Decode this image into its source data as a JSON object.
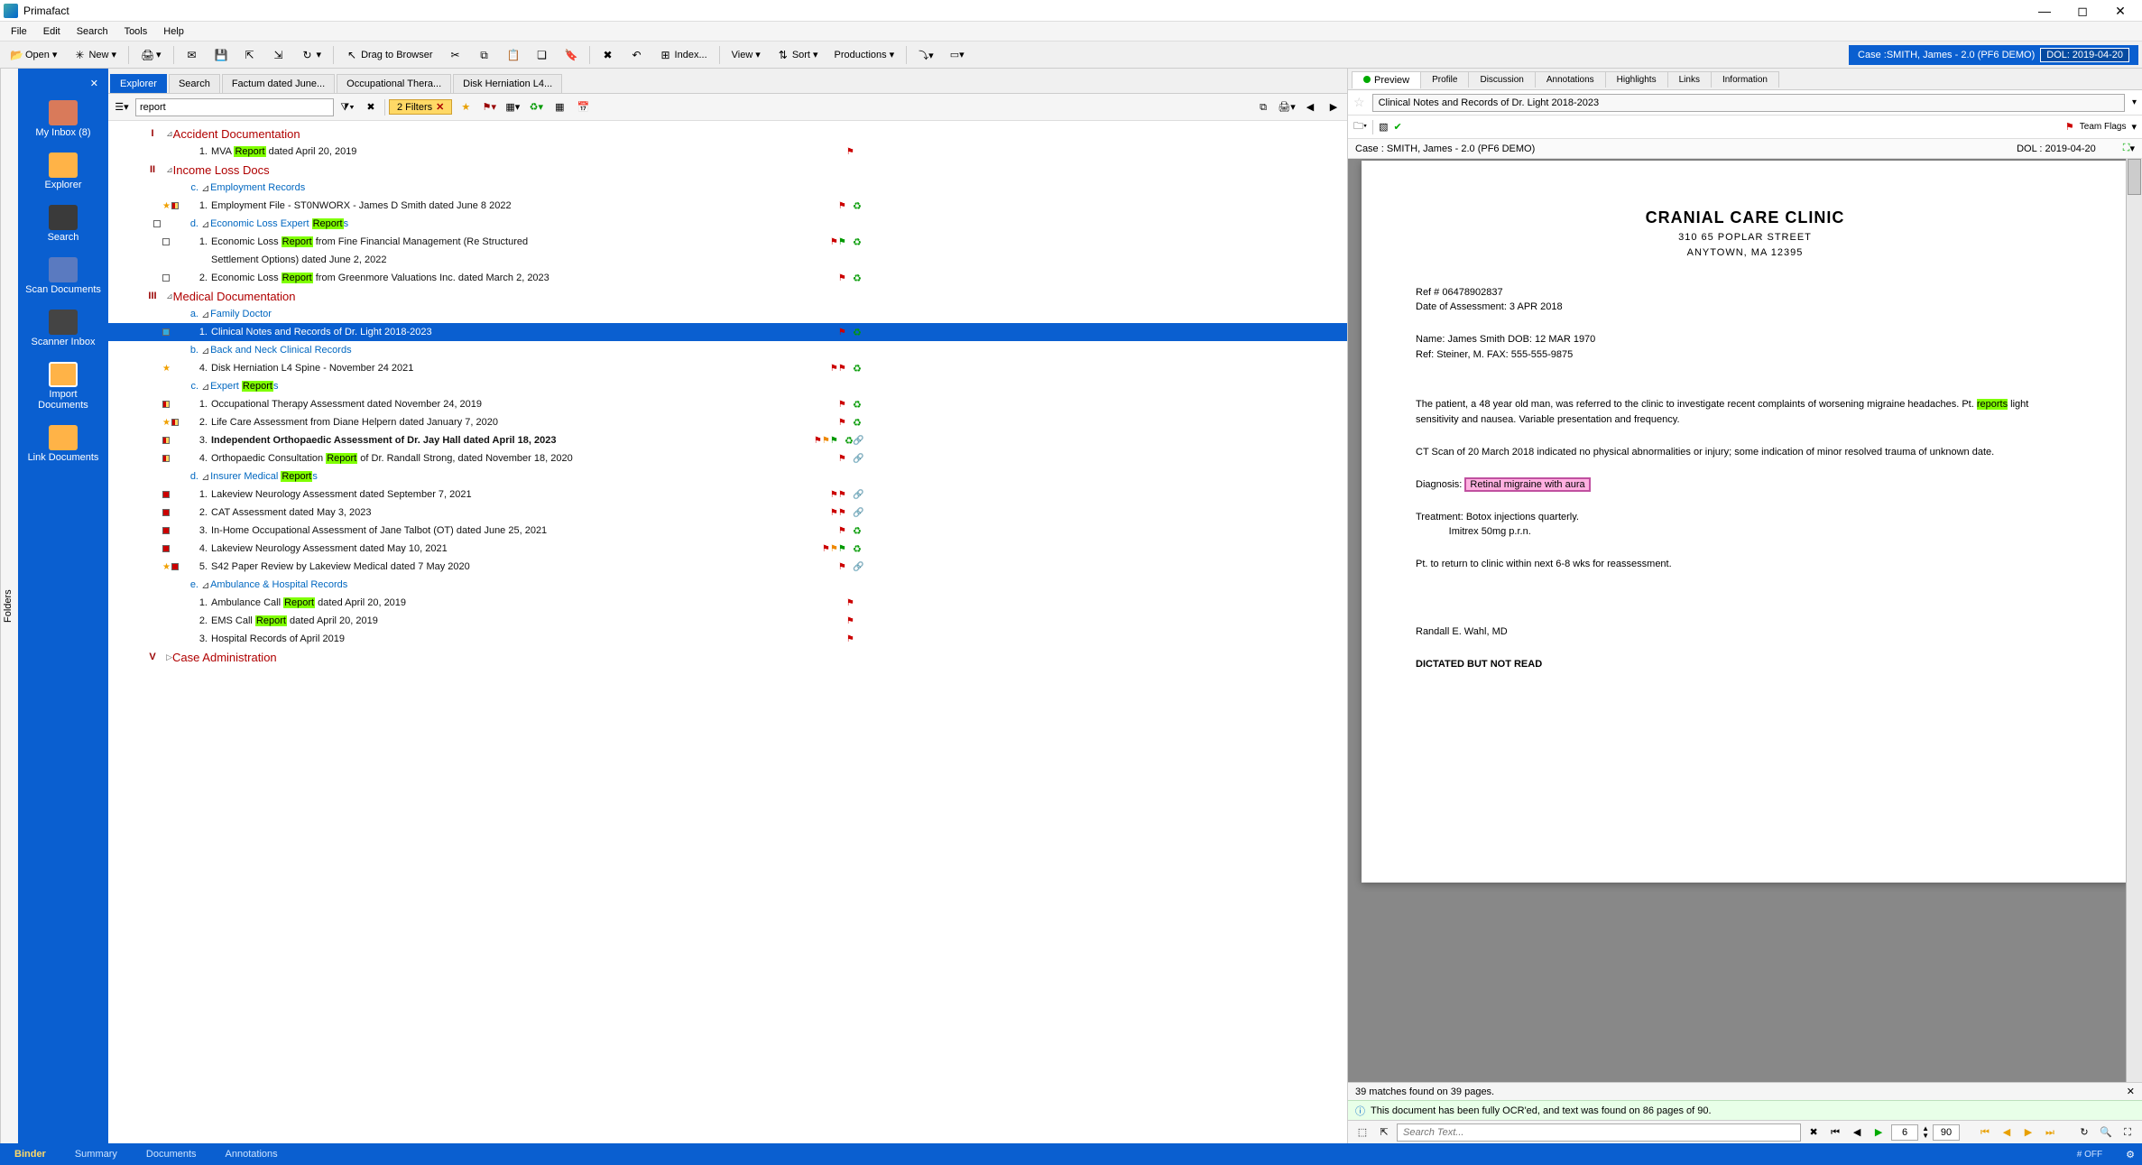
{
  "app": {
    "title": "Primafact"
  },
  "menu": [
    "File",
    "Edit",
    "Search",
    "Tools",
    "Help"
  ],
  "toolbar": {
    "open": "Open",
    "new": "New",
    "drag_to_browser": "Drag to Browser",
    "index": "Index...",
    "view": "View",
    "sort": "Sort",
    "productions": "Productions"
  },
  "case_banner": {
    "prefix": "Case : ",
    "name": "SMITH, James - 2.0 (PF6 DEMO)",
    "dol_label": "DOL:",
    "dol": "2019-04-20"
  },
  "leftbar": [
    {
      "id": "inbox",
      "label": "My Inbox (8)"
    },
    {
      "id": "explorer",
      "label": "Explorer"
    },
    {
      "id": "search",
      "label": "Search"
    },
    {
      "id": "scan",
      "label": "Scan Documents"
    },
    {
      "id": "scanner",
      "label": "Scanner Inbox"
    },
    {
      "id": "import",
      "label": "Import Documents"
    },
    {
      "id": "link",
      "label": "Link Documents"
    }
  ],
  "folders_tab": "Folders",
  "center_tabs": [
    "Explorer",
    "Search",
    "Factum dated June...",
    "Occupational Thera...",
    "Disk Herniation L4..."
  ],
  "explorer_search": {
    "value": "report",
    "filters_pill": "2 Filters"
  },
  "tree": [
    {
      "t": "sec",
      "num": "I",
      "title": "Accident Documentation"
    },
    {
      "t": "doc",
      "idx": "1.",
      "parts": [
        "MVA ",
        {
          "hl": "Report"
        },
        " dated April 20, 2019"
      ],
      "flags": [
        "red"
      ]
    },
    {
      "t": "sec",
      "num": "II",
      "title": "Income Loss Docs"
    },
    {
      "t": "sub",
      "ltr": "c.",
      "title": "Employment Records"
    },
    {
      "t": "doc",
      "idx": "1.",
      "gutter": "star-half",
      "parts": [
        "Employment File - ST0NWORX - James D Smith dated June 8 2022"
      ],
      "flags": [
        "red"
      ],
      "icons": [
        "recycle"
      ]
    },
    {
      "t": "sub",
      "ltr": "d.",
      "title_parts": [
        "Economic Loss Expert ",
        {
          "hl": "Report"
        },
        "s"
      ],
      "gutter": "sq"
    },
    {
      "t": "doc",
      "idx": "1.",
      "gutter": "sq",
      "parts": [
        "Economic Loss ",
        {
          "hl": "Report"
        },
        " from Fine Financial Management (Re Structured"
      ],
      "flags": [
        "red",
        "green"
      ],
      "icons": [
        "recycle"
      ]
    },
    {
      "t": "docc",
      "parts": [
        "Settlement Options) dated June 2, 2022"
      ]
    },
    {
      "t": "doc",
      "idx": "2.",
      "gutter": "sq",
      "parts": [
        "Economic Loss ",
        {
          "hl": "Report"
        },
        " from Greenmore Valuations Inc. dated March 2, 2023"
      ],
      "flags": [
        "red"
      ],
      "icons": [
        "recycle"
      ]
    },
    {
      "t": "sec",
      "num": "III",
      "title": "Medical Documentation"
    },
    {
      "t": "sub",
      "ltr": "a.",
      "title": "Family Doctor"
    },
    {
      "t": "doc",
      "idx": "1.",
      "selected": true,
      "gutter": "blue",
      "parts": [
        "Clinical Notes and Records of Dr. Light 2018-2023"
      ],
      "flags": [
        "red"
      ],
      "icons": [
        "recycle"
      ]
    },
    {
      "t": "sub",
      "ltr": "b.",
      "title": "Back and Neck Clinical Records"
    },
    {
      "t": "doc",
      "idx": "4.",
      "gutter": "star",
      "parts": [
        "Disk Herniation L4  Spine - November 24 2021"
      ],
      "flags": [
        "red",
        "red"
      ],
      "icons": [
        "recycle"
      ]
    },
    {
      "t": "sub",
      "ltr": "c.",
      "title_parts": [
        "Expert ",
        {
          "hl": "Report"
        },
        "s"
      ]
    },
    {
      "t": "doc",
      "idx": "1.",
      "gutter": "half",
      "parts": [
        "Occupational Therapy Assessment dated November 24, 2019"
      ],
      "flags": [
        "red"
      ],
      "icons": [
        "recycle"
      ]
    },
    {
      "t": "doc",
      "idx": "2.",
      "gutter": "star-half",
      "parts": [
        "Life Care Assessment from Diane Helpern dated January 7, 2020"
      ],
      "flags": [
        "red"
      ],
      "icons": [
        "recycle"
      ]
    },
    {
      "t": "doc",
      "idx": "3.",
      "gutter": "half",
      "bold": true,
      "parts": [
        "Independent Orthopaedic Assessment of Dr. Jay Hall dated April 18, 2023"
      ],
      "flags": [
        "red",
        "orange",
        "green"
      ],
      "icons": [
        "recycle",
        "link"
      ]
    },
    {
      "t": "doc",
      "idx": "4.",
      "gutter": "half",
      "parts": [
        "Orthopaedic Consultation ",
        {
          "hl": "Report"
        },
        " of Dr. Randall Strong, dated November 18, 2020"
      ],
      "flags": [
        "red"
      ],
      "icons": [
        "link"
      ]
    },
    {
      "t": "sub",
      "ltr": "d.",
      "title_parts": [
        "Insurer Medical ",
        {
          "hl": "Report"
        },
        "s"
      ]
    },
    {
      "t": "doc",
      "idx": "1.",
      "gutter": "red",
      "parts": [
        "Lakeview Neurology Assessment dated September 7, 2021"
      ],
      "flags": [
        "red",
        "red"
      ],
      "icons": [
        "link"
      ]
    },
    {
      "t": "doc",
      "idx": "2.",
      "gutter": "red",
      "parts": [
        "CAT Assessment dated May 3, 2023"
      ],
      "flags": [
        "red",
        "red"
      ],
      "icons": [
        "link"
      ]
    },
    {
      "t": "doc",
      "idx": "3.",
      "gutter": "red",
      "parts": [
        "In-Home Occupational Assessment of Jane Talbot (OT) dated June 25, 2021"
      ],
      "flags": [
        "red"
      ],
      "icons": [
        "recycle"
      ]
    },
    {
      "t": "doc",
      "idx": "4.",
      "gutter": "red",
      "parts": [
        "Lakeview Neurology Assessment dated May 10, 2021"
      ],
      "flags": [
        "red",
        "orange",
        "green"
      ],
      "icons": [
        "recycle"
      ]
    },
    {
      "t": "doc",
      "idx": "5.",
      "gutter": "star-red",
      "parts": [
        "S42 Paper Review by Lakeview Medical dated 7 May 2020"
      ],
      "flags": [
        "red"
      ],
      "icons": [
        "link"
      ]
    },
    {
      "t": "sub",
      "ltr": "e.",
      "title": "Ambulance & Hospital Records"
    },
    {
      "t": "doc",
      "idx": "1.",
      "parts": [
        "Ambulance Call ",
        {
          "hl": "Report"
        },
        " dated April 20, 2019"
      ],
      "flags": [
        "red"
      ]
    },
    {
      "t": "doc",
      "idx": "2.",
      "parts": [
        "EMS Call ",
        {
          "hl": "Report"
        },
        " dated April 20, 2019"
      ],
      "flags": [
        "red"
      ]
    },
    {
      "t": "doc",
      "idx": "3.",
      "parts": [
        "Hospital Records of April 2019"
      ],
      "flags": [
        "red"
      ]
    },
    {
      "t": "sec",
      "num": "V",
      "title": "Case Administration",
      "collapsed": true
    }
  ],
  "right_tabs": [
    "Preview",
    "Profile",
    "Discussion",
    "Annotations",
    "Highlights",
    "Links",
    "Information"
  ],
  "doc_title": "Clinical Notes and Records of Dr. Light 2018-2023",
  "team_flags_label": "Team Flags",
  "doc_case": "Case : SMITH, James - 2.0 (PF6 DEMO)",
  "doc_dol": "DOL : 2019-04-20",
  "document": {
    "letterhead": {
      "name": "CRANIAL CARE CLINIC",
      "addr1": "310 65 POPLAR STREET",
      "addr2": "ANYTOWN, MA 12395"
    },
    "ref_line": "Ref # 06478902837",
    "date_line": "Date of Assessment: 3 APR 2018",
    "name_line": "Name:  James Smith   DOB: 12 MAR 1970",
    "ref2_line": "Ref:   Steiner, M.   FAX: 555-555-9875",
    "para1a": "The patient, a 48 year old man, was referred to the clinic to investigate recent complaints of worsening migraine headaches. Pt. ",
    "para1_hl": "reports",
    "para1b": " light sensitivity and nausea.  Variable presentation and frequency.",
    "para2": "CT Scan of 20 March 2018 indicated no physical abnormalities or injury; some indication of minor resolved trauma of unknown date.",
    "diag_label": "Diagnosis:  ",
    "diag_hl": "Retinal migraine with aura",
    "treat1": "Treatment:  Botox injections quarterly.",
    "treat2": "            Imitrex 50mg p.r.n.",
    "followup": "Pt. to return to clinic within next 6-8 wks for reassessment.",
    "sig": "Randall E. Wahl, MD",
    "dictated": "DICTATED BUT NOT READ"
  },
  "matches_bar": "39 matches found on 39 pages.",
  "ocr_bar": "This document has been fully OCR'ed, and text was found on 86 pages of 90.",
  "doc_footer": {
    "search_placeholder": "Search Text...",
    "page_current": "6",
    "page_total": "90"
  },
  "bottom_tabs": [
    "Binder",
    "Summary",
    "Documents",
    "Annotations"
  ],
  "status_off": "# OFF"
}
